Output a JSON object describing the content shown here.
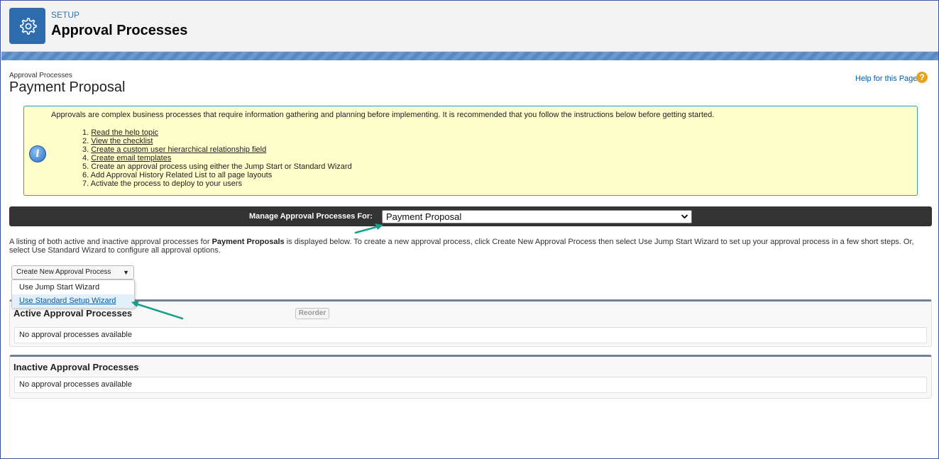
{
  "header": {
    "setup_label": "SETUP",
    "title": "Approval Processes"
  },
  "page": {
    "breadcrumb": "Approval Processes",
    "title": "Payment Proposal",
    "help_link": "Help for this Page"
  },
  "info": {
    "intro": "Approvals are complex business processes that require information gathering and planning before implementing. It is recommended that you follow the instructions below before getting started.",
    "steps": [
      {
        "num": "1. ",
        "text": "Read the help topic"
      },
      {
        "num": "2. ",
        "text": "View the checklist"
      },
      {
        "num": "3. ",
        "text": "Create a custom user hierarchical relationship field"
      },
      {
        "num": "4. ",
        "text": "Create email templates"
      },
      {
        "num": "5. ",
        "text": "Create an approval process using either the Jump Start or Standard Wizard"
      },
      {
        "num": "6. ",
        "text": "Add Approval History Related List to all page layouts"
      },
      {
        "num": "7. ",
        "text": "Activate the process to deploy to your users"
      }
    ]
  },
  "manage": {
    "label": "Manage Approval Processes For:",
    "selected": "Payment Proposal"
  },
  "description": {
    "before": "A listing of both active and inactive approval processes for ",
    "object": "Payment Proposals",
    "after": " is displayed below. To create a new approval process, click Create New Approval Process then select Use Jump Start Wizard to set up your approval process in a few short steps. Or, select Use Standard Wizard to configure all approval options."
  },
  "create_menu": {
    "button_label": "Create New Approval Process",
    "items": [
      "Use Jump Start Wizard",
      "Use Standard Setup Wizard"
    ]
  },
  "active_section": {
    "title": "Active Approval Processes",
    "reorder_label": "Reorder",
    "empty_text": "No approval processes available"
  },
  "inactive_section": {
    "title": "Inactive Approval Processes",
    "empty_text": "No approval processes available"
  },
  "colors": {
    "header_icon_bg": "#2f6cad",
    "annotation_arrow": "#16a085",
    "info_bg": "#ffffcc",
    "manage_bar_bg": "#333333"
  }
}
